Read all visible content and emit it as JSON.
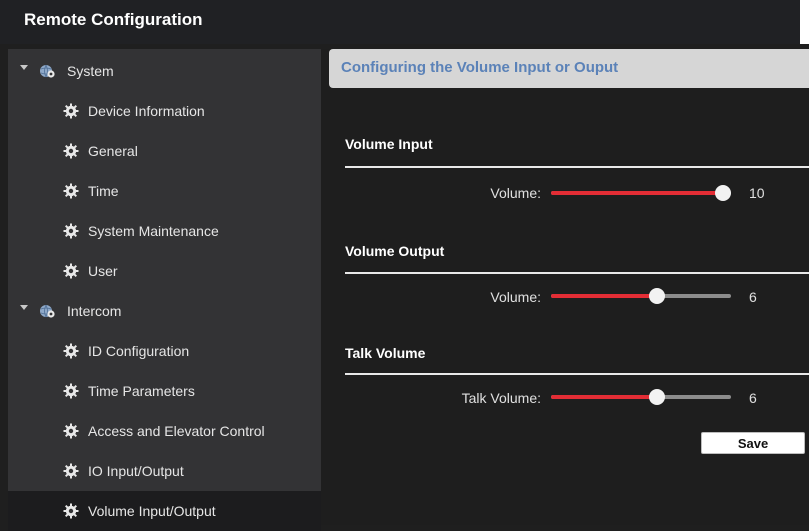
{
  "window": {
    "title": "Remote Configuration"
  },
  "sidebar": {
    "groups": [
      {
        "label": "System",
        "expanded": true,
        "items": [
          {
            "label": "Device Information"
          },
          {
            "label": "General"
          },
          {
            "label": "Time"
          },
          {
            "label": "System Maintenance"
          },
          {
            "label": "User"
          }
        ]
      },
      {
        "label": "Intercom",
        "expanded": true,
        "items": [
          {
            "label": "ID Configuration"
          },
          {
            "label": "Time Parameters"
          },
          {
            "label": "Access and Elevator Control"
          },
          {
            "label": "IO Input/Output"
          },
          {
            "label": "Volume Input/Output",
            "selected": true
          }
        ]
      }
    ]
  },
  "main": {
    "header": "Configuring the Volume Input or Ouput",
    "sections": [
      {
        "title": "Volume Input",
        "field_label": "Volume:",
        "value": "10",
        "max": 10
      },
      {
        "title": "Volume Output",
        "field_label": "Volume:",
        "value": "6",
        "max": 10
      },
      {
        "title": "Talk Volume",
        "field_label": "Talk Volume:",
        "value": "6",
        "max": 10
      }
    ],
    "save_label": "Save"
  },
  "colors": {
    "accent_red": "#e32d35",
    "header_text_blue": "#5b82b8",
    "sidebar_bg": "#333335",
    "selected_bg": "#1c1c1e"
  },
  "icons": {
    "group": "globe-gear-icon",
    "leaf": "gear-icon",
    "expand": "chevron-down-icon"
  }
}
